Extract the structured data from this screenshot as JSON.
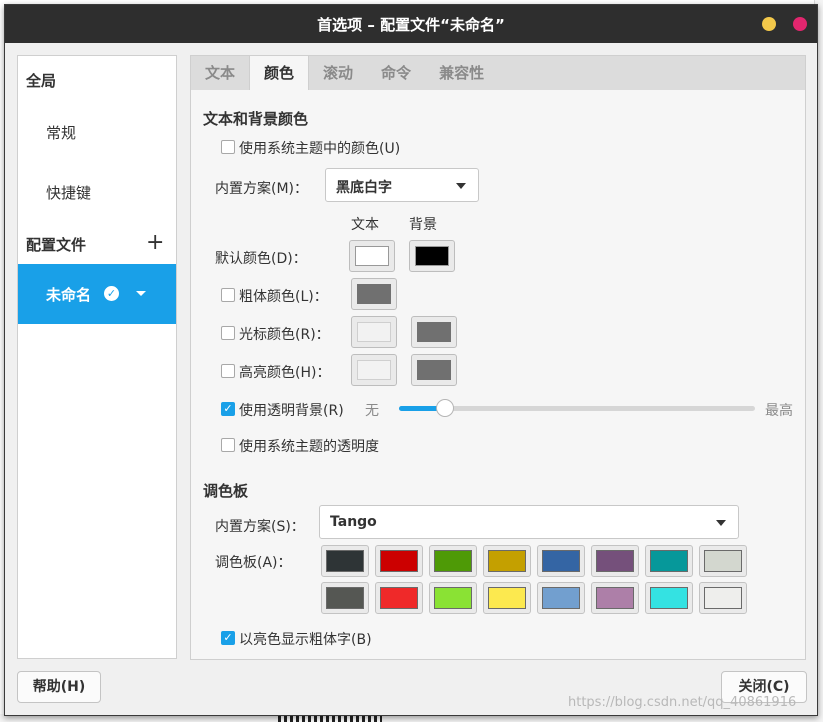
{
  "window": {
    "title": "首选项 – 配置文件“未命名”"
  },
  "sidebar": {
    "global_header": "全局",
    "global_items": [
      "常规",
      "快捷键"
    ],
    "profiles_header": "配置文件",
    "selected_profile": "未命名"
  },
  "tabs": [
    "文本",
    "颜色",
    "滚动",
    "命令",
    "兼容性"
  ],
  "active_tab": "颜色",
  "colors": {
    "section_title": "文本和背景颜色",
    "use_system_theme_colors": {
      "label": "使用系统主题中的颜色(U)",
      "checked": false
    },
    "builtin_scheme_label": "内置方案(M)：",
    "builtin_scheme_value": "黑底白字",
    "col_text": "文本",
    "col_bg": "背景",
    "default_color_label": "默认颜色(D)：",
    "default_text_color": "#ffffff",
    "default_bg_color": "#000000",
    "bold_color": {
      "label": "粗体颜色(L)：",
      "checked": false,
      "color": "#707070"
    },
    "cursor_color": {
      "label": "光标颜色(R)：",
      "checked": false,
      "text": "#f2f2f2",
      "bg": "#707070"
    },
    "highlight_color": {
      "label": "高亮颜色(H)：",
      "checked": false,
      "text": "#f2f2f2",
      "bg": "#707070"
    },
    "transparent_bg": {
      "label": "使用透明背景(R)",
      "checked": true,
      "min_label": "无",
      "max_label": "最高",
      "value": 0.13
    },
    "system_transparency": {
      "label": "使用系统主题的透明度",
      "checked": false
    }
  },
  "palette": {
    "section_title": "调色板",
    "builtin_scheme_label": "内置方案(S)：",
    "builtin_scheme_value": "Tango",
    "palette_label": "调色板(A)：",
    "row1": [
      "#2e3436",
      "#cc0000",
      "#4e9a06",
      "#c4a000",
      "#3465a4",
      "#75507b",
      "#06989a",
      "#d3d7cf"
    ],
    "row2": [
      "#555753",
      "#ef2929",
      "#8ae234",
      "#fce94f",
      "#729fcf",
      "#ad7fa8",
      "#34e2e2",
      "#eeeeec"
    ],
    "bold_bright": {
      "label": "以亮色显示粗体字(B)",
      "checked": true
    }
  },
  "buttons": {
    "help": "帮助(H)",
    "close": "关闭(C)"
  },
  "watermark": "https://blog.csdn.net/qq_40861916",
  "accent": "#19a0e8"
}
